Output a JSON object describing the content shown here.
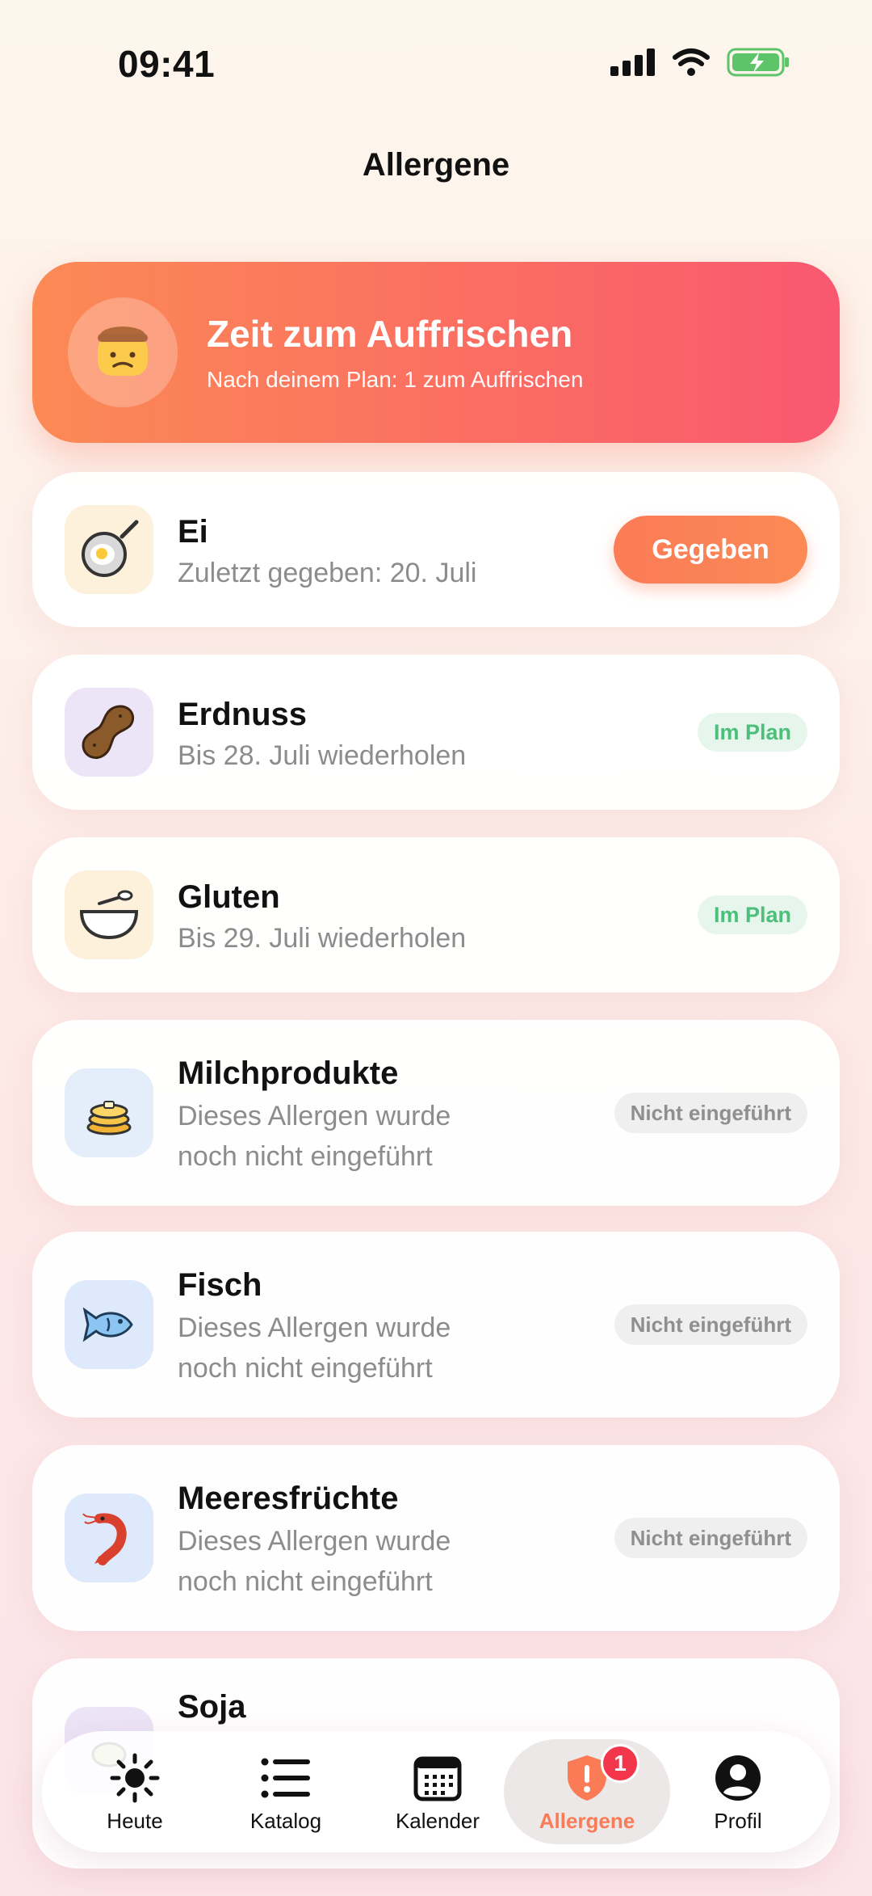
{
  "status": {
    "time": "09:41"
  },
  "nav": {
    "title": "Allergene"
  },
  "banner": {
    "title": "Zeit zum Auffrischen",
    "subtitle": "Nach deinem Plan: 1 zum Auffrischen",
    "gradient": [
      "#fb8a55",
      "#f95870"
    ]
  },
  "allergens": [
    {
      "name": "Ei",
      "detail_line1": "Zuletzt gegeben: 20. Juli",
      "detail_line2": "",
      "action": "Gegeben",
      "status": "",
      "icon": "frying-pan-egg-icon"
    },
    {
      "name": "Erdnuss",
      "detail_line1": "Bis 28. Juli wiederholen",
      "detail_line2": "",
      "status": "Im Plan",
      "icon": "peanut-icon"
    },
    {
      "name": "Gluten",
      "detail_line1": "Bis 29. Juli wiederholen",
      "detail_line2": "",
      "status": "Im Plan",
      "icon": "bowl-spoon-icon"
    },
    {
      "name": "Milchprodukte",
      "detail_line1": "Dieses Allergen wurde",
      "detail_line2": "noch nicht eingeführt",
      "status": "Nicht eingeführt",
      "icon": "pancakes-icon"
    },
    {
      "name": "Fisch",
      "detail_line1": "Dieses Allergen wurde",
      "detail_line2": "noch nicht eingeführt",
      "status": "Nicht eingeführt",
      "icon": "fish-icon"
    },
    {
      "name": "Meeresfrüchte",
      "detail_line1": "Dieses Allergen wurde",
      "detail_line2": "noch nicht eingeführt",
      "status": "Nicht eingeführt",
      "icon": "shrimp-icon"
    },
    {
      "name": "Soja",
      "detail_line1": "",
      "detail_line2": "",
      "status": "",
      "icon": "soy-icon"
    }
  ],
  "tabs": [
    {
      "label": "Heute",
      "icon": "sun-icon"
    },
    {
      "label": "Katalog",
      "icon": "list-icon"
    },
    {
      "label": "Kalender",
      "icon": "calendar-icon"
    },
    {
      "label": "Allergene",
      "icon": "shield-alert-icon",
      "active": true,
      "badge": "1"
    },
    {
      "label": "Profil",
      "icon": "person-icon"
    }
  ],
  "colors": {
    "accent": "#fb7b57",
    "plan_green": "#4cbf7b",
    "badge_red": "#f4364c"
  }
}
